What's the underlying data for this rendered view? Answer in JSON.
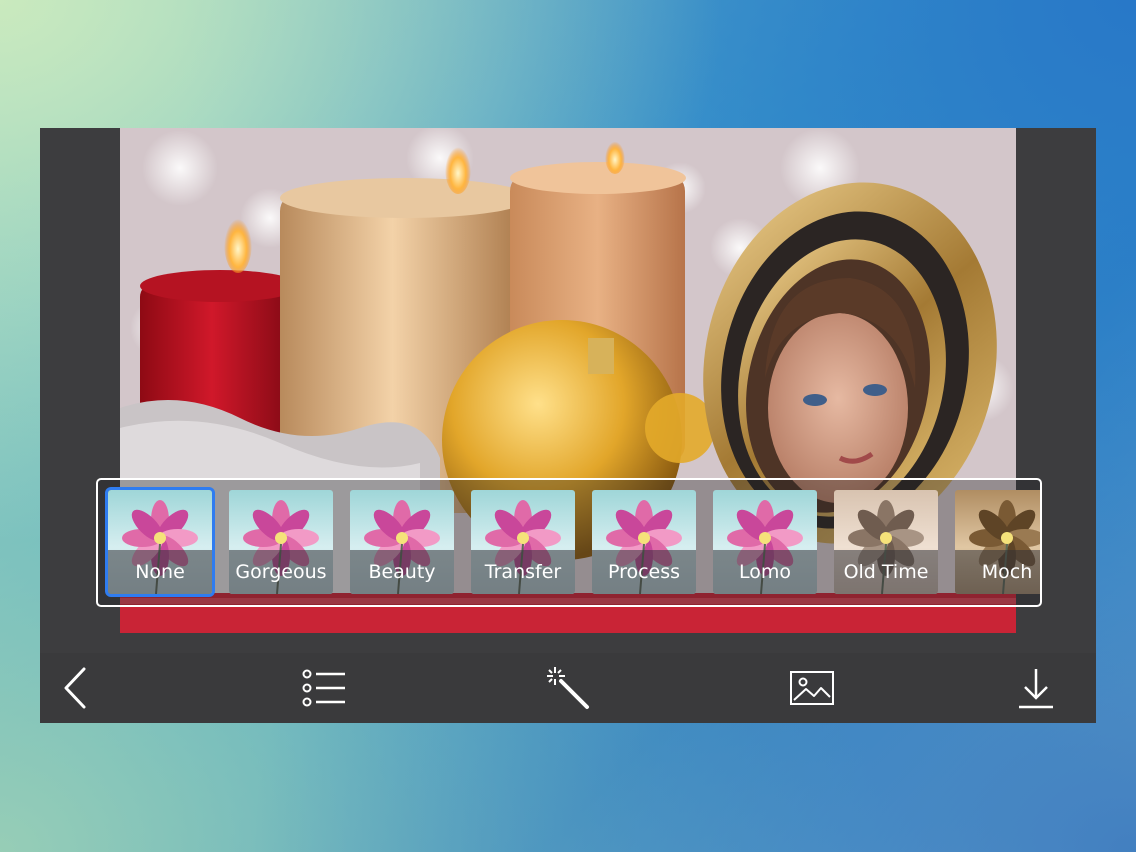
{
  "filters": {
    "items": [
      {
        "label": "None",
        "selected": true,
        "tone": "cool"
      },
      {
        "label": "Gorgeous",
        "selected": false,
        "tone": "cool"
      },
      {
        "label": "Beauty",
        "selected": false,
        "tone": "cool"
      },
      {
        "label": "Transfer",
        "selected": false,
        "tone": "cool"
      },
      {
        "label": "Process",
        "selected": false,
        "tone": "cool"
      },
      {
        "label": "Lomo",
        "selected": false,
        "tone": "cool"
      },
      {
        "label": "Old Time",
        "selected": false,
        "tone": "warm"
      },
      {
        "label": "Moch",
        "selected": false,
        "tone": "mocha"
      }
    ],
    "selected_color": "#2f7cf0"
  },
  "toolbar": {
    "icons": [
      "chevron-left-icon",
      "list-icon",
      "magic-wand-icon",
      "image-icon",
      "download-icon"
    ]
  },
  "colors": {
    "frame": "#3d3d3f",
    "toolbar": "#3a3a3c",
    "icon": "#ffffff"
  }
}
